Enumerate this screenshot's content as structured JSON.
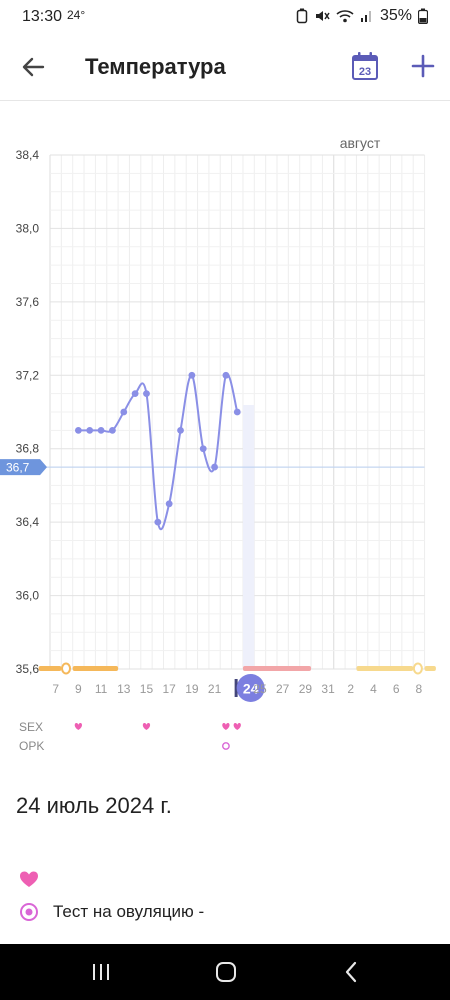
{
  "status_bar": {
    "time": "13:30",
    "temperature": "24°",
    "battery": "35%"
  },
  "app_bar": {
    "title": "Температура",
    "calendar_day": "23"
  },
  "chart_data": {
    "type": "line",
    "month_label": "август",
    "y_ticks": [
      "38,4",
      "38,0",
      "37,6",
      "37,2",
      "36,8",
      "36,4",
      "36,0",
      "35,6"
    ],
    "ylim": [
      35.6,
      38.4
    ],
    "x_tick_labels": [
      "7",
      "9",
      "11",
      "13",
      "15",
      "17",
      "19",
      "21",
      "24",
      "25",
      "27",
      "29",
      "31",
      "2",
      "4",
      "6",
      "8"
    ],
    "selected_day": "24",
    "cover_line": {
      "value": 36.7,
      "label": "36,7"
    },
    "series": [
      {
        "days": [
          "9",
          "10",
          "11",
          "12",
          "13",
          "14",
          "15",
          "16",
          "17",
          "18",
          "19",
          "20",
          "21",
          "22",
          "23"
        ],
        "values": [
          36.9,
          36.9,
          36.9,
          36.9,
          37.0,
          37.1,
          37.1,
          36.4,
          36.5,
          36.9,
          37.2,
          36.8,
          36.7,
          37.2,
          37.0
        ]
      }
    ],
    "sex_row_label": "SEX",
    "opk_row_label": "OPK",
    "sex_days": [
      "9",
      "15",
      "22",
      "23"
    ],
    "opk_days": [
      "22"
    ],
    "colors": {
      "line": "#8a8fe6",
      "menstruation": "#f5b85a",
      "fertile": "#f2a6a8",
      "predicted_menstruation": "#f7d98d",
      "cover_line": "#b9cef0",
      "heart": "#ee5fb3",
      "opk": "#d966d6",
      "selected": "#7c7fe0"
    }
  },
  "day_details": {
    "date": "24 июль 2024 г.",
    "ovulation_test_label": "Тест на овуляцию -"
  },
  "icons": {
    "back": "arrow-left-icon",
    "calendar": "calendar-icon",
    "add": "plus-icon",
    "heart": "heart-icon",
    "ovulation": "ovulation-test-icon"
  }
}
